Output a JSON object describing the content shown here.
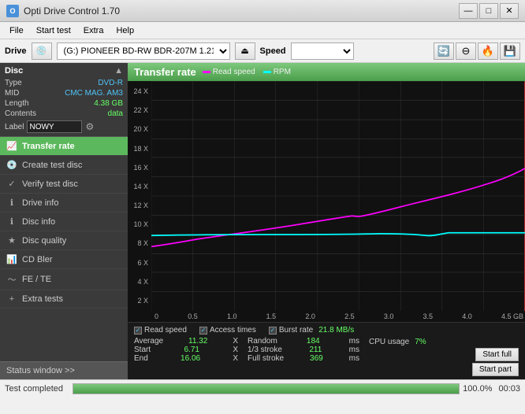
{
  "window": {
    "title": "Opti Drive Control 1.70",
    "title_icon": "O"
  },
  "titlebar": {
    "minimize": "—",
    "maximize": "□",
    "close": "✕"
  },
  "menu": {
    "items": [
      "File",
      "Start test",
      "Extra",
      "Help"
    ]
  },
  "drive_bar": {
    "drive_label": "Drive",
    "drive_value": "(G:)  PIONEER BD-RW   BDR-207M 1.21",
    "speed_label": "Speed",
    "speed_placeholder": ""
  },
  "disc": {
    "title": "Disc",
    "type_label": "Type",
    "type_value": "DVD-R",
    "mid_label": "MID",
    "mid_value": "CMC MAG. AM3",
    "length_label": "Length",
    "length_value": "4.38 GB",
    "contents_label": "Contents",
    "contents_value": "data",
    "label_label": "Label",
    "label_value": "NOWY"
  },
  "sidebar": {
    "nav_items": [
      {
        "id": "transfer-rate",
        "label": "Transfer rate",
        "active": true
      },
      {
        "id": "create-test-disc",
        "label": "Create test disc",
        "active": false
      },
      {
        "id": "verify-test-disc",
        "label": "Verify test disc",
        "active": false
      },
      {
        "id": "drive-info",
        "label": "Drive info",
        "active": false
      },
      {
        "id": "disc-info",
        "label": "Disc info",
        "active": false
      },
      {
        "id": "disc-quality",
        "label": "Disc quality",
        "active": false
      },
      {
        "id": "cd-bler",
        "label": "CD Bler",
        "active": false
      },
      {
        "id": "fe-te",
        "label": "FE / TE",
        "active": false
      },
      {
        "id": "extra-tests",
        "label": "Extra tests",
        "active": false
      }
    ],
    "status_window": "Status window >>"
  },
  "chart": {
    "title": "Transfer rate",
    "legend": [
      {
        "label": "Read speed",
        "color": "#ff00ff"
      },
      {
        "label": "RPM",
        "color": "#00ffff"
      }
    ],
    "y_labels": [
      "24 X",
      "22 X",
      "20 X",
      "18 X",
      "16 X",
      "14 X",
      "12 X",
      "10 X",
      "8 X",
      "6 X",
      "4 X",
      "2 X"
    ],
    "x_labels": [
      "0",
      "0.5",
      "1.0",
      "1.5",
      "2.0",
      "2.5",
      "3.0",
      "3.5",
      "4.0",
      "4.5 GB"
    ]
  },
  "stats": {
    "checkboxes": [
      {
        "label": "Read speed",
        "checked": true
      },
      {
        "label": "Access times",
        "checked": true
      },
      {
        "label": "Burst rate",
        "checked": true
      },
      {
        "burst_value": "21.8 MB/s"
      }
    ],
    "rows": [
      {
        "label": "Average",
        "value": "11.32",
        "unit": "X",
        "label2": "Random",
        "value2": "184",
        "unit2": "ms",
        "label3": "CPU usage",
        "value3": "7%",
        "btn": null
      },
      {
        "label": "Start",
        "value": "6.71",
        "unit": "X",
        "label2": "1/3 stroke",
        "value2": "211",
        "unit2": "ms",
        "btn": "Start full"
      },
      {
        "label": "End",
        "value": "16.06",
        "unit": "X",
        "label2": "Full stroke",
        "value2": "369",
        "unit2": "ms",
        "btn": "Start part"
      }
    ]
  },
  "status_bar": {
    "text": "Test completed",
    "progress": 100,
    "progress_text": "100.0%",
    "time": "00:03"
  }
}
